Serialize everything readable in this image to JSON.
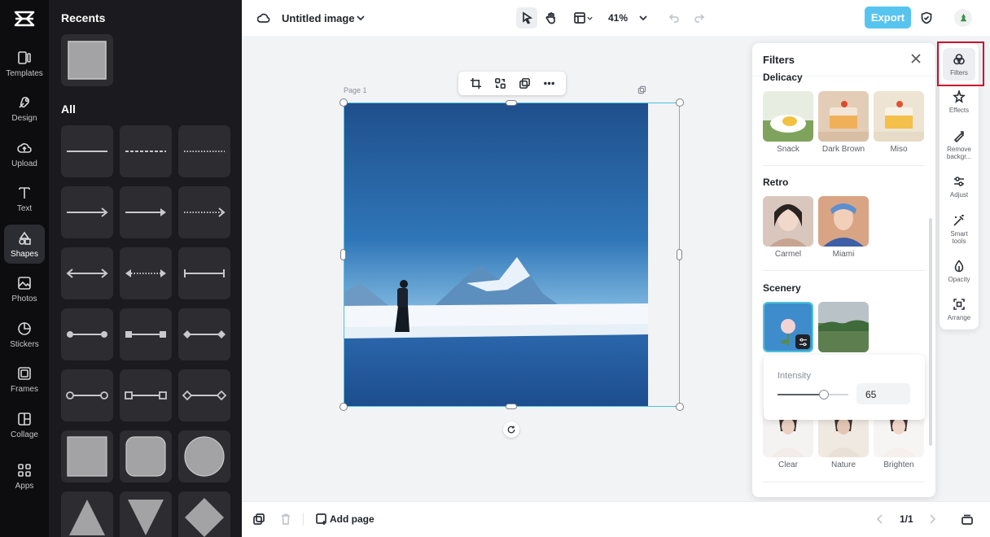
{
  "left_rail": {
    "items": [
      {
        "label": "Templates",
        "icon": "templates-icon"
      },
      {
        "label": "Design",
        "icon": "design-icon"
      },
      {
        "label": "Upload",
        "icon": "upload-icon"
      },
      {
        "label": "Text",
        "icon": "text-icon"
      },
      {
        "label": "Shapes",
        "icon": "shapes-icon",
        "active": true
      },
      {
        "label": "Photos",
        "icon": "photos-icon"
      },
      {
        "label": "Stickers",
        "icon": "stickers-icon"
      },
      {
        "label": "Frames",
        "icon": "frames-icon"
      },
      {
        "label": "Collage",
        "icon": "collage-icon"
      },
      {
        "label": "Apps",
        "icon": "apps-icon"
      }
    ]
  },
  "shapes_panel": {
    "recents_title": "Recents",
    "all_title": "All"
  },
  "topbar": {
    "title": "Untitled image",
    "zoom": "41%",
    "export_label": "Export"
  },
  "canvas": {
    "page_label": "Page 1"
  },
  "filters": {
    "title": "Filters",
    "sections": [
      {
        "title": "Delicacy",
        "items": [
          "Snack",
          "Dark Brown",
          "Miso"
        ]
      },
      {
        "title": "Retro",
        "items": [
          "Carmel",
          "Miami"
        ]
      },
      {
        "title": "Scenery",
        "items": []
      },
      {
        "title": "",
        "items": [
          "Clear",
          "Nature",
          "Brighten"
        ]
      }
    ],
    "intensity_label": "Intensity",
    "intensity_value": "65",
    "intensity_level": 0.65
  },
  "right_rail": {
    "items": [
      "Filters",
      "Effects",
      "Remove backgr...",
      "Adjust",
      "Smart tools",
      "Opacity",
      "Arrange"
    ]
  },
  "bottombar": {
    "add_page_label": "Add page",
    "page_counter": "1/1"
  },
  "colors": {
    "accent": "#57c4f0",
    "selection": "#4cc3db",
    "highlight_box": "#c8102e"
  }
}
